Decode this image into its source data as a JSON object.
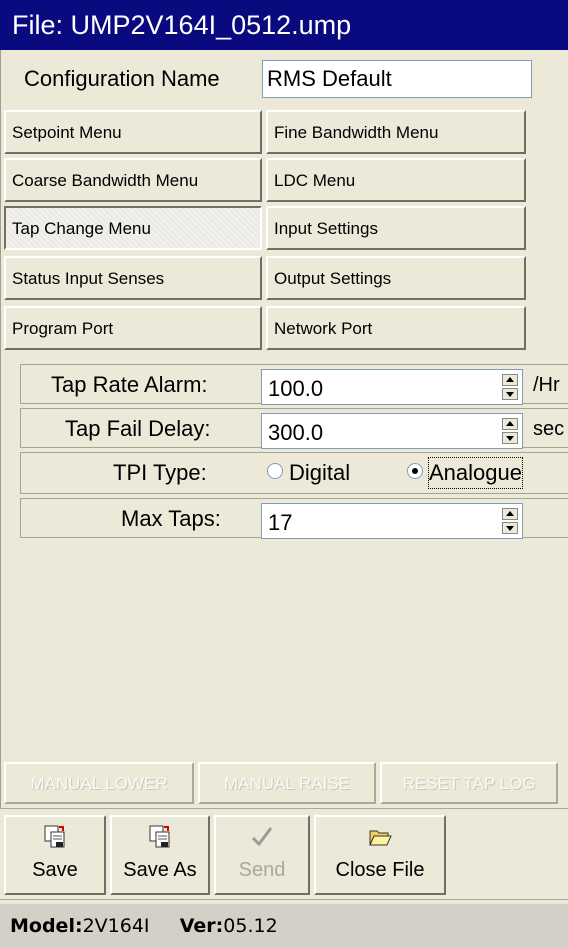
{
  "window": {
    "title": "File: UMP2V164I_0512.ump"
  },
  "config": {
    "label": "Configuration Name",
    "value": "RMS Default"
  },
  "menu": {
    "setpoint": "Setpoint Menu",
    "fine_bandwidth": "Fine Bandwidth Menu",
    "coarse_bandwidth": "Coarse Bandwidth Menu",
    "ldc": "LDC Menu",
    "tap_change": "Tap Change Menu",
    "input_settings": "Input Settings",
    "status_input": "Status Input Senses",
    "output_settings": "Output Settings",
    "program_port": "Program Port",
    "network_port": "Network Port",
    "active": "Tap Change Menu"
  },
  "settings": {
    "tap_rate_alarm": {
      "label": "Tap Rate Alarm:",
      "value": "100.0",
      "unit": "/Hr"
    },
    "tap_fail_delay": {
      "label": "Tap Fail Delay:",
      "value": "300.0",
      "unit": "sec"
    },
    "tpi_type": {
      "label": "TPI Type:",
      "options": [
        "Digital",
        "Analogue"
      ],
      "selected": "Analogue"
    },
    "max_taps": {
      "label": "Max Taps:",
      "value": "17"
    }
  },
  "actions": {
    "manual_lower": "MANUAL LOWER",
    "manual_raise": "MANUAL RAISE",
    "reset_tap_log": "RESET TAP LOG"
  },
  "toolbar": {
    "save": "Save",
    "save_as": "Save As",
    "send": "Send",
    "close_file": "Close File"
  },
  "status": {
    "model_label": "Model:",
    "model_value": "2V164I",
    "ver_label": "Ver:",
    "ver_value": "05.12"
  }
}
